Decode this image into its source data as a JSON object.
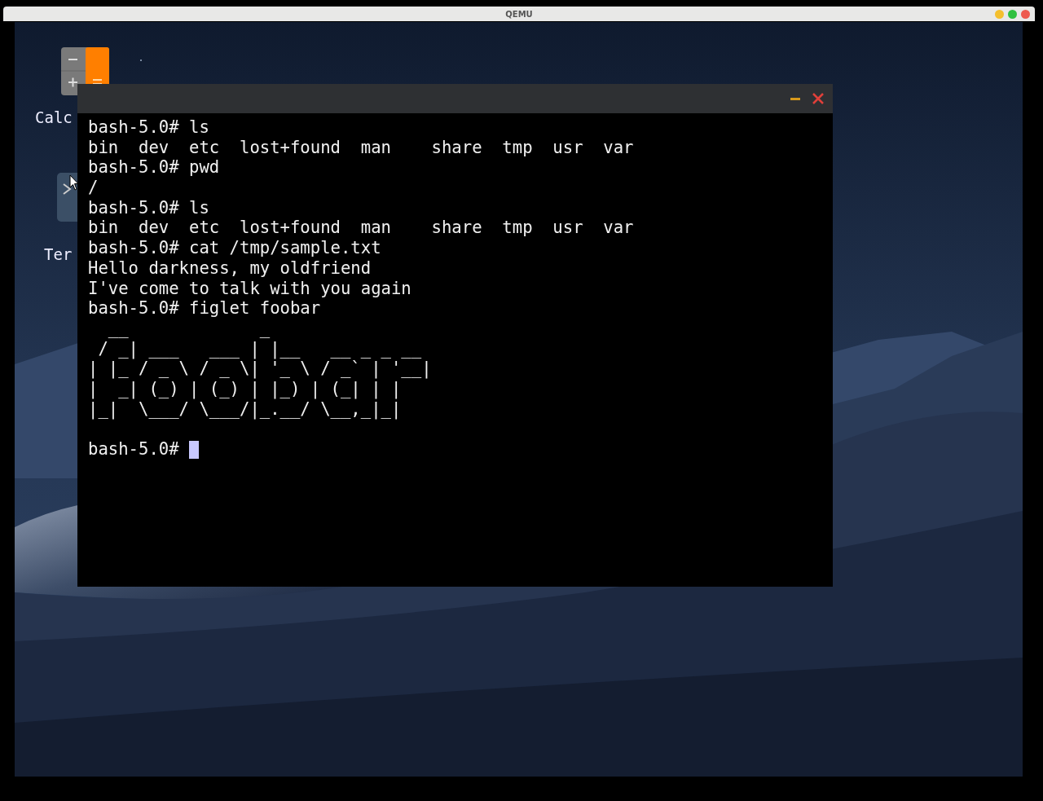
{
  "window": {
    "title": "QEMU"
  },
  "desktop": {
    "icons": [
      {
        "kind": "calculator",
        "label": "Calc"
      },
      {
        "kind": "terminal",
        "label": "Ter"
      }
    ]
  },
  "terminal": {
    "cursor": true,
    "lines": [
      {
        "kind": "text",
        "text": "bash-5.0# ls"
      },
      {
        "kind": "text",
        "text": "bin  dev  etc  lost+found  man    share  tmp  usr  var"
      },
      {
        "kind": "text",
        "text": "bash-5.0# pwd"
      },
      {
        "kind": "text",
        "text": "/"
      },
      {
        "kind": "text",
        "text": "bash-5.0# ls"
      },
      {
        "kind": "text",
        "text": "bin  dev  etc  lost+found  man    share  tmp  usr  var"
      },
      {
        "kind": "text",
        "text": "bash-5.0# cat /tmp/sample.txt"
      },
      {
        "kind": "text",
        "text": "Hello darkness, my oldfriend"
      },
      {
        "kind": "text",
        "text": "I've come to talk with you again"
      },
      {
        "kind": "text",
        "text": "bash-5.0# figlet foobar"
      },
      {
        "kind": "art",
        "text": "  __             _"
      },
      {
        "kind": "art",
        "text": " / _| ___   ___ | |__   __ _ _ __"
      },
      {
        "kind": "art",
        "text": "| |_ / _ \\ / _ \\| '_ \\ / _` | '__|"
      },
      {
        "kind": "art",
        "text": "|  _| (_) | (_) | |_) | (_| | |"
      },
      {
        "kind": "art",
        "text": "|_|  \\___/ \\___/|_.__/ \\__,_|_|"
      },
      {
        "kind": "blank"
      },
      {
        "kind": "prompt",
        "text": "bash-5.0#"
      }
    ]
  }
}
